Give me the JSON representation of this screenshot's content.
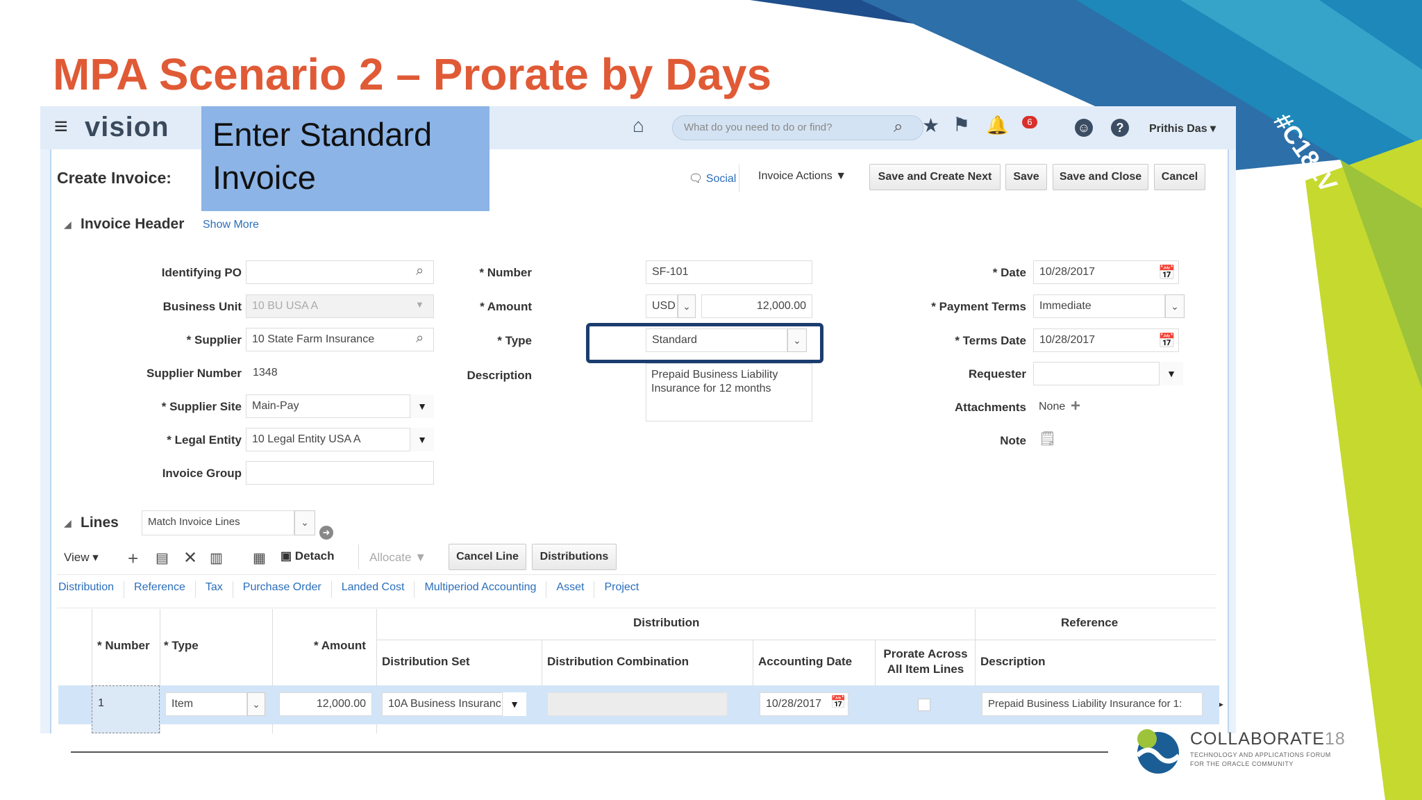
{
  "slide": {
    "title": "MPA Scenario 2 – Prorate by Days",
    "hashtag": "#C18LV",
    "footer_brand": "COLLABORATE",
    "footer_brand_num": "18",
    "footer_tagline1": "TECHNOLOGY AND APPLICATIONS FORUM",
    "footer_tagline2": "FOR THE ORACLE COMMUNITY",
    "callout": "Enter Standard Invoice"
  },
  "topbar": {
    "logo": "vision",
    "search_placeholder": "What do you need to do or find?",
    "notification_count": "6",
    "user_name": "Prithis Das"
  },
  "header": {
    "page_title": "Create Invoice:",
    "social_label": "Social",
    "actions_label": "Invoice Actions",
    "save_create_next": "Save and Create Next",
    "save": "Save",
    "save_close": "Save and Close",
    "cancel": "Cancel"
  },
  "invoice_header": {
    "section_title": "Invoice Header",
    "show_more": "Show More",
    "fields": {
      "identifying_po": {
        "label": "Identifying PO",
        "value": ""
      },
      "business_unit": {
        "label": "Business Unit",
        "value": "10 BU USA A"
      },
      "supplier": {
        "label": "Supplier",
        "value": "10 State Farm Insurance"
      },
      "supplier_number": {
        "label": "Supplier Number",
        "value": "1348"
      },
      "supplier_site": {
        "label": "Supplier Site",
        "value": "Main-Pay"
      },
      "legal_entity": {
        "label": "Legal Entity",
        "value": "10 Legal Entity USA A"
      },
      "invoice_group": {
        "label": "Invoice Group",
        "value": ""
      },
      "number": {
        "label": "Number",
        "value": "SF-101"
      },
      "amount": {
        "label": "Amount",
        "currency": "USD",
        "value": "12,000.00"
      },
      "type": {
        "label": "Type",
        "value": "Standard"
      },
      "description": {
        "label": "Description",
        "value": "Prepaid Business Liability Insurance for 12 months"
      },
      "date": {
        "label": "Date",
        "value": "10/28/2017"
      },
      "payment_terms": {
        "label": "Payment Terms",
        "value": "Immediate"
      },
      "terms_date": {
        "label": "Terms Date",
        "value": "10/28/2017"
      },
      "requester": {
        "label": "Requester",
        "value": ""
      },
      "attachments": {
        "label": "Attachments",
        "value": "None"
      },
      "note": {
        "label": "Note"
      }
    }
  },
  "lines": {
    "section_title": "Lines",
    "match_select": "Match Invoice Lines",
    "view_label": "View",
    "detach": "Detach",
    "allocate": "Allocate",
    "cancel_line": "Cancel Line",
    "distributions": "Distributions",
    "tabs": [
      "Distribution",
      "Reference",
      "Tax",
      "Purchase Order",
      "Landed Cost",
      "Multiperiod Accounting",
      "Asset",
      "Project"
    ],
    "group_distribution": "Distribution",
    "group_reference": "Reference",
    "columns": {
      "number": "Number",
      "type": "Type",
      "amount": "Amount",
      "dist_set": "Distribution Set",
      "dist_combination": "Distribution Combination",
      "accounting_date": "Accounting Date",
      "prorate1": "Prorate Across",
      "prorate2": "All Item Lines",
      "description": "Description"
    },
    "rows": [
      {
        "number": "1",
        "type": "Item",
        "amount": "12,000.00",
        "dist_set": "10A Business Insuranc",
        "dist_combination": "",
        "accounting_date": "10/28/2017",
        "description": "Prepaid Business Liability Insurance for 1:"
      }
    ]
  },
  "colors": {
    "title": "#e05a36",
    "callout_bg": "#8cb4e6",
    "highlight_border": "#1b3d6e",
    "link": "#2a6ebb",
    "notification_badge": "#d9302b"
  }
}
